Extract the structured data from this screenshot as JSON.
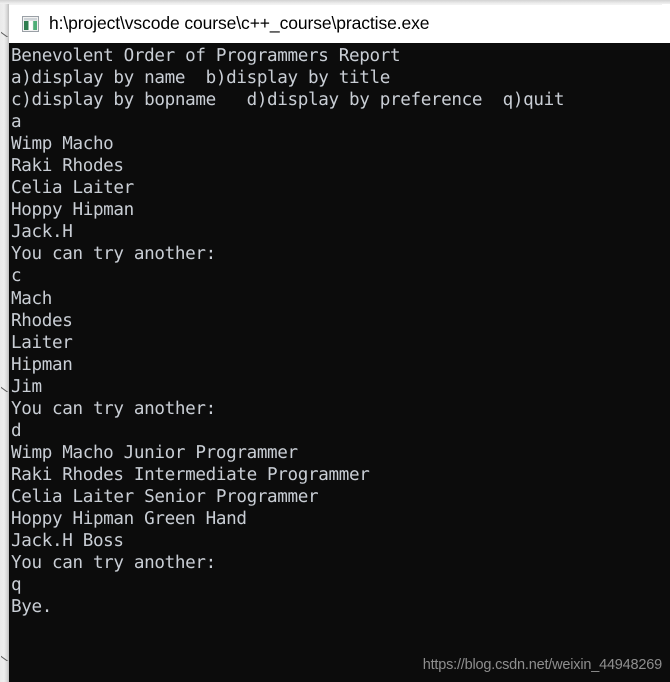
{
  "window": {
    "title": "h:\\project\\vscode course\\c++_course\\practise.exe",
    "icon": "console-window-icon",
    "titlebar_bg": "#ffffff",
    "titlebar_text_color": "#000000"
  },
  "console": {
    "background": "#0c0c0c",
    "text_color": "#c9ced5",
    "lines": [
      "Benevolent Order of Programmers Report",
      "a)display by name  b)display by title",
      "c)display by bopname   d)display by preference  q)quit",
      "a",
      "Wimp Macho",
      "Raki Rhodes",
      "Celia Laiter",
      "Hoppy Hipman",
      "Jack.H",
      "You can try another:",
      "c",
      "Mach",
      "Rhodes",
      "Laiter",
      "Hipman",
      "Jim",
      "You can try another:",
      "d",
      "Wimp Macho Junior Programmer",
      "Raki Rhodes Intermediate Programmer",
      "Celia Laiter Senior Programmer",
      "Hoppy Hipman Green Hand",
      "Jack.H Boss",
      "You can try another:",
      "q",
      "Bye."
    ],
    "menu_options": [
      {
        "key": "a",
        "label": "display by name"
      },
      {
        "key": "b",
        "label": "display by title"
      },
      {
        "key": "c",
        "label": "display by bopname"
      },
      {
        "key": "d",
        "label": "display by preference"
      },
      {
        "key": "q",
        "label": "quit"
      }
    ],
    "commands_entered": [
      "a",
      "c",
      "d",
      "q"
    ],
    "prompt": "You can try another:",
    "exit_message": "Bye."
  },
  "watermark": {
    "text": "https://blog.csdn.net/weixin_44948269",
    "color": "#8e8e8e"
  }
}
